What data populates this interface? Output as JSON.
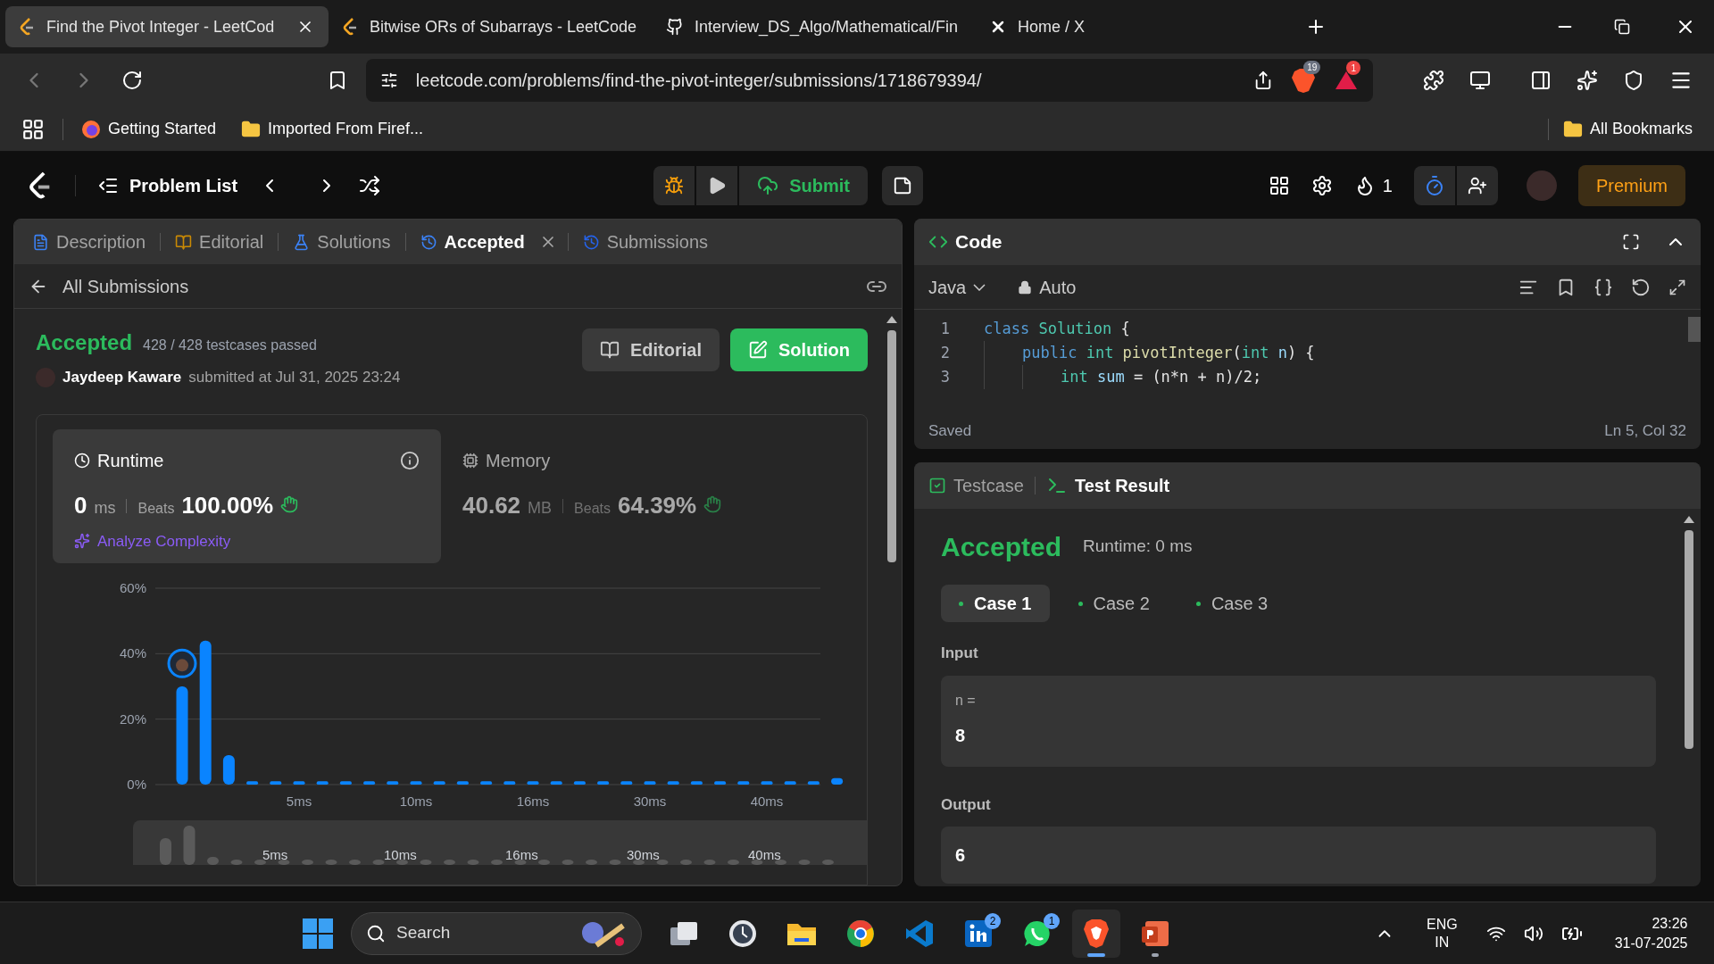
{
  "browser_tabs": [
    {
      "title": "Find the Pivot Integer - LeetCod",
      "kind": "leetcode",
      "selected": true
    },
    {
      "title": "Bitwise ORs of Subarrays - LeetCode",
      "kind": "leetcode",
      "selected": false
    },
    {
      "title": "Interview_DS_Algo/Mathematical/Fin",
      "kind": "github",
      "selected": false
    },
    {
      "title": "Home / X",
      "kind": "x",
      "selected": false
    }
  ],
  "address_bar": {
    "url": "leetcode.com/problems/find-the-pivot-integer/submissions/1718679394/",
    "shield_count": "19",
    "alert_count": "1"
  },
  "bookmarks": [
    {
      "label": "Getting Started",
      "kind": "firefox"
    },
    {
      "label": "Imported From Firef...",
      "kind": "folder"
    }
  ],
  "all_bookmarks": "All Bookmarks",
  "header": {
    "problem_list": "Problem List",
    "submit": "Submit",
    "streak": "1",
    "premium": "Premium"
  },
  "left_tabs": [
    {
      "label": "Description",
      "kind": "doc",
      "selected": false
    },
    {
      "label": "Editorial",
      "kind": "book",
      "selected": false
    },
    {
      "label": "Solutions",
      "kind": "flask",
      "selected": false
    },
    {
      "label": "Accepted",
      "kind": "history",
      "selected": true,
      "closable": true
    },
    {
      "label": "Submissions",
      "kind": "history",
      "selected": false
    }
  ],
  "back_link": "All Submissions",
  "submission": {
    "status": "Accepted",
    "testcases": "428 / 428 testcases passed",
    "user": "Jaydeep Kaware",
    "submitted": "submitted at Jul 31, 2025 23:24",
    "editorial_button": "Editorial",
    "solution_button": "Solution"
  },
  "metrics": [
    {
      "title": "Runtime",
      "kind": "clock",
      "selected": true,
      "value": "0",
      "unit": "ms",
      "beats_label": "Beats",
      "beats": "100.00%",
      "extra": "Analyze Complexity"
    },
    {
      "title": "Memory",
      "kind": "chip",
      "selected": false,
      "value": "40.62",
      "unit": "MB",
      "beats_label": "Beats",
      "beats": "64.39%"
    }
  ],
  "chart_data": {
    "type": "bar",
    "categories": [
      null,
      null,
      null,
      null,
      null,
      "5ms",
      null,
      null,
      null,
      null,
      "10ms",
      null,
      null,
      null,
      null,
      "16ms",
      null,
      null,
      null,
      null,
      "30ms",
      null,
      null,
      null,
      null,
      "40ms",
      null,
      null,
      null
    ],
    "values": [
      30,
      44,
      9,
      1,
      1,
      1,
      1,
      1,
      1,
      1,
      1,
      1,
      1,
      1,
      1,
      1,
      1,
      1,
      1,
      1,
      1,
      1,
      1,
      1,
      1,
      1,
      1,
      1,
      2
    ],
    "ylim": [
      0,
      60
    ],
    "yticks": [
      {
        "value": 0,
        "label": "0%"
      },
      {
        "value": 20,
        "label": "20%"
      },
      {
        "value": 40,
        "label": "40%"
      },
      {
        "value": 60,
        "label": "60%"
      }
    ]
  },
  "overview_labels": [
    "5ms",
    "10ms",
    "16ms",
    "30ms",
    "40ms"
  ],
  "code_panel": {
    "title": "Code",
    "language": "Java",
    "mode": "Auto",
    "status": "Saved",
    "cursor": "Ln 5, Col 32",
    "lines": [
      {
        "number": "1",
        "tokens": [
          {
            "text": "class",
            "kind": "keyword"
          },
          {
            "text": " Solution",
            "kind": "type"
          },
          {
            "text": " {"
          }
        ],
        "children": [
          {
            "number": "2",
            "tokens": [
              {
                "text": "public",
                "kind": "keyword"
              },
              {
                "text": " int",
                "kind": "type"
              },
              {
                "text": " pivotInteger",
                "kind": "function"
              },
              {
                "text": "("
              },
              {
                "text": "int",
                "kind": "type"
              },
              {
                "text": " n",
                "kind": "variable"
              },
              {
                "text": ") {"
              }
            ],
            "children": [
              {
                "number": "3",
                "tokens": [
                  {
                    "text": "int",
                    "kind": "type"
                  },
                  {
                    "text": " sum",
                    "kind": "variable"
                  },
                  {
                    "text": " = (n*n + n)/2;"
                  }
                ]
              }
            ]
          }
        ]
      }
    ]
  },
  "result_tabs": [
    {
      "label": "Testcase",
      "kind": "check",
      "selected": false
    },
    {
      "label": "Test Result",
      "kind": "terminal",
      "selected": true
    }
  ],
  "result": {
    "status": "Accepted",
    "runtime": "Runtime: 0 ms",
    "cases": [
      {
        "label": "Case 1",
        "selected": true
      },
      {
        "label": "Case 2",
        "selected": false
      },
      {
        "label": "Case 3",
        "selected": false
      }
    ],
    "input_label": "Input",
    "input_name": "n =",
    "input_value": "8",
    "output_label": "Output",
    "output_value": "6"
  },
  "taskbar": {
    "search": "Search",
    "apps": [
      {
        "kind": "stack",
        "active": false,
        "running": false
      },
      {
        "kind": "clock",
        "active": false,
        "running": false
      },
      {
        "kind": "folder",
        "active": false,
        "running": false
      },
      {
        "kind": "chrome",
        "active": false,
        "running": false
      },
      {
        "kind": "editor",
        "active": false,
        "running": false
      },
      {
        "kind": "linkedin",
        "badge": "2",
        "active": false,
        "running": false
      },
      {
        "kind": "chat",
        "badge": "1",
        "active": false,
        "running": false
      },
      {
        "kind": "lion",
        "active": true,
        "running": true
      },
      {
        "kind": "slides",
        "active": false,
        "running": true
      }
    ],
    "language": "ENG",
    "region": "IN",
    "time": "23:26",
    "date": "31-07-2025"
  }
}
